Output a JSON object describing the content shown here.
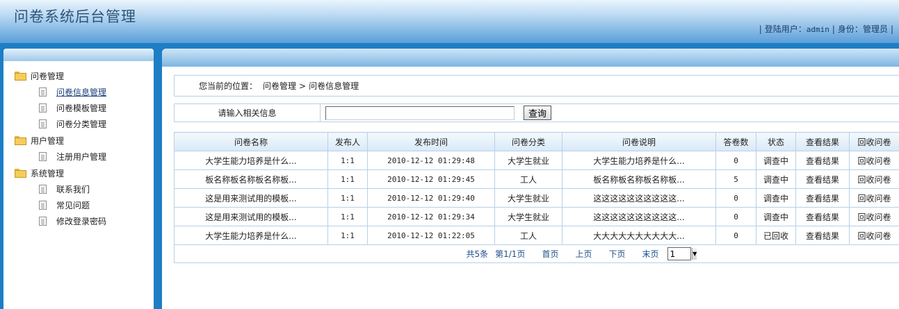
{
  "header": {
    "title": "问卷系统后台管理",
    "user_label": "登陆用户：",
    "user_name": "admin",
    "role_label": "身份：",
    "role_name": "管理员"
  },
  "sidebar": {
    "groups": [
      {
        "label": "问卷管理",
        "items": [
          "问卷信息管理",
          "问卷模板管理",
          "问卷分类管理"
        ]
      },
      {
        "label": "用户管理",
        "items": [
          "注册用户管理"
        ]
      },
      {
        "label": "系统管理",
        "items": [
          "联系我们",
          "常见问题",
          "修改登录密码"
        ]
      }
    ]
  },
  "breadcrumb": {
    "prefix": "您当前的位置：",
    "level1": "问卷管理",
    "separator": ">",
    "level2": "问卷信息管理"
  },
  "search": {
    "label": "请输入相关信息",
    "value": "",
    "button": "查询"
  },
  "table": {
    "headers": [
      "问卷名称",
      "发布人",
      "发布时间",
      "问卷分类",
      "问卷说明",
      "答卷数",
      "状态",
      "查看结果",
      "回收问卷"
    ],
    "rows": [
      [
        "大学生能力培养是什么...",
        "1:1",
        "2010-12-12 01:29:48",
        "大学生就业",
        "大学生能力培养是什么...",
        "0",
        "调查中",
        "查看结果",
        "回收问卷"
      ],
      [
        "板名称板名称板名称板...",
        "1:1",
        "2010-12-12 01:29:45",
        "工人",
        "板名称板名称板名称板...",
        "5",
        "调查中",
        "查看结果",
        "回收问卷"
      ],
      [
        "这是用来测试用的模板...",
        "1:1",
        "2010-12-12 01:29:40",
        "大学生就业",
        "这这这这这这这这这这...",
        "0",
        "调查中",
        "查看结果",
        "回收问卷"
      ],
      [
        "这是用来测试用的模板...",
        "1:1",
        "2010-12-12 01:29:34",
        "大学生就业",
        "这这这这这这这这这这...",
        "0",
        "调查中",
        "查看结果",
        "回收问卷"
      ],
      [
        "大学生能力培养是什么...",
        "1:1",
        "2010-12-12 01:22:05",
        "工人",
        "大大大大大大大大大大...",
        "0",
        "已回收",
        "查看结果",
        "回收问卷"
      ]
    ]
  },
  "pager": {
    "total": "共5条",
    "page_info": "第1/1页",
    "first": "首页",
    "prev": "上页",
    "next": "下页",
    "last": "末页",
    "current_page": "1"
  }
}
